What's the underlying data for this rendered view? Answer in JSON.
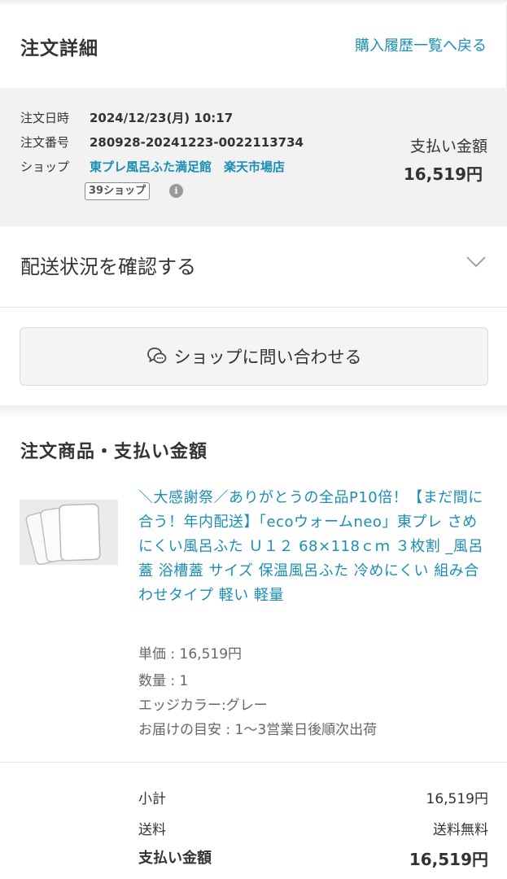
{
  "header": {
    "title": "注文詳細",
    "back_link": "購入履歴一覧へ戻る"
  },
  "summary": {
    "date_label": "注文日時",
    "date_value": "2024/12/23(月) 10:17",
    "number_label": "注文番号",
    "number_value": "280928-20241223-0022113734",
    "shop_label": "ショップ",
    "shop_name": "東プレ風呂ふた満足館　楽天市場店",
    "shop_badge": "39ショップ",
    "info_icon": "i",
    "payment_label": "支払い金額",
    "payment_amount": "16,519円"
  },
  "delivery": {
    "label": "配送状況を確認する",
    "icon": "chevron-down-icon"
  },
  "contact_button": {
    "label": "ショップに問い合わせる",
    "icon": "chat-bubble-icon"
  },
  "items_section": {
    "title": "注文商品・支払い金額",
    "product": {
      "name": "＼大感謝祭／ありがとうの全品P10倍！【まだ間に合う！年内配送】「ecoウォームneo」東プレ さめにくい風呂ふた Ｕ１２ 68×118ｃｍ ３枚割 _風呂蓋 浴槽蓋 サイズ 保温風呂ふた 冷めにくい 組み合わせタイプ 軽い 軽量",
      "unit_price": "単価 : 16,519円",
      "quantity": "数量 : 1",
      "edge_color": "エッジカラー:グレー",
      "delivery_estimate": "お届けの目安 : 1〜3営業日後順次出荷"
    }
  },
  "totals": {
    "subtotal_label": "小計",
    "subtotal_value": "16,519円",
    "shipping_label": "送料",
    "shipping_value": "送料無料",
    "total_label": "支払い金額",
    "total_value": "16,519円"
  },
  "colors": {
    "link": "#1a8fb3",
    "summary_bg": "#f2f2f2",
    "button_bg": "#f4f4f4"
  }
}
